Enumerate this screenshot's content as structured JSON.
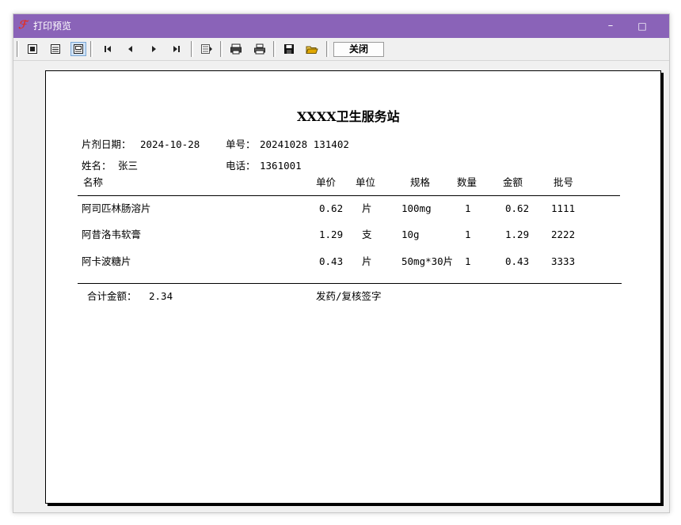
{
  "window": {
    "title": "打印预览",
    "minimize": "–",
    "maximize": "□"
  },
  "toolbar": {
    "close_label": "关闭"
  },
  "report": {
    "station": "XXXX卫生服务站",
    "date_label": "片剂日期：",
    "date_value": "2024-10-28",
    "order_label": "单号：",
    "order_value": "20241028 131402",
    "name_label": "姓名：",
    "name_value": "张三",
    "phone_label": "电话：",
    "phone_value": "1361001",
    "columns": [
      "名称",
      "单价",
      "单位",
      "规格",
      "数量",
      "金额",
      "批号"
    ],
    "rows": [
      {
        "name": "阿司匹林肠溶片",
        "price": "0.62",
        "unit": "片",
        "spec": "100mg",
        "qty": "1",
        "amount": "0.62",
        "batch": "1111"
      },
      {
        "name": "阿昔洛韦软膏",
        "price": "1.29",
        "unit": "支",
        "spec": "10g",
        "qty": "1",
        "amount": "1.29",
        "batch": "2222"
      },
      {
        "name": "阿卡波糖片",
        "price": "0.43",
        "unit": "片",
        "spec": "50mg*30片",
        "qty": "1",
        "amount": "0.43",
        "batch": "3333"
      }
    ],
    "total_label": "合计金额：",
    "total_value": "2.34",
    "signature_label": "发药/复核签字"
  }
}
